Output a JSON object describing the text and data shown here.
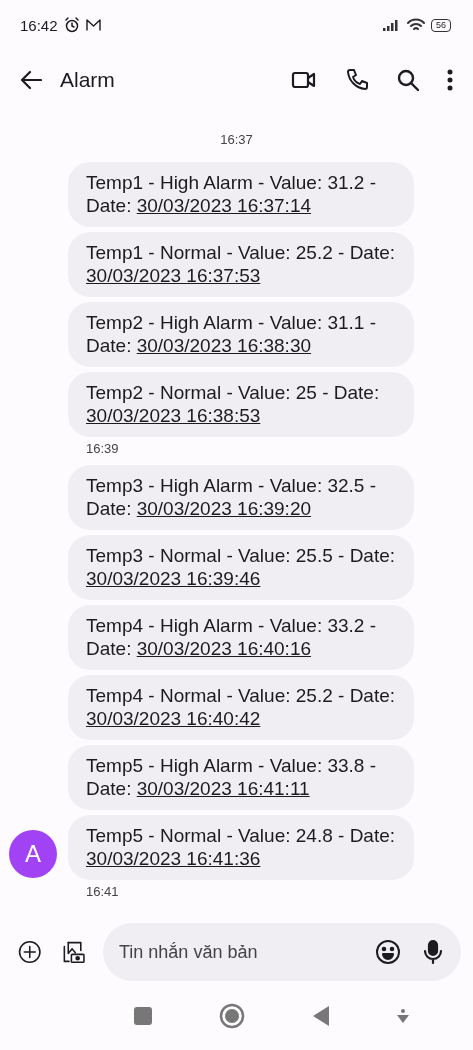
{
  "status_bar": {
    "time": "16:42",
    "battery": "56"
  },
  "header": {
    "title": "Alarm"
  },
  "thread": [
    {
      "kind": "divider",
      "time": "16:37"
    },
    {
      "kind": "message",
      "text": "Temp1 - High Alarm - Value: 31.2 - Date: ",
      "date": "30/03/2023 16:37:14"
    },
    {
      "kind": "message",
      "text": "Temp1 - Normal - Value: 25.2 - Date: ",
      "date": "30/03/2023 16:37:53"
    },
    {
      "kind": "message",
      "text": "Temp2 - High Alarm - Value: 31.1 - Date: ",
      "date": "30/03/2023 16:38:30"
    },
    {
      "kind": "message",
      "text": "Temp2 - Normal - Value: 25 - Date: ",
      "date": "30/03/2023 16:38:53"
    },
    {
      "kind": "stamp",
      "time": "16:39"
    },
    {
      "kind": "message",
      "text": "Temp3 - High Alarm - Value: 32.5 - Date: ",
      "date": "30/03/2023 16:39:20"
    },
    {
      "kind": "message",
      "text": "Temp3 - Normal - Value: 25.5 - Date: ",
      "date": "30/03/2023 16:39:46"
    },
    {
      "kind": "message",
      "text": "Temp4 - High Alarm - Value: 33.2 - Date: ",
      "date": "30/03/2023 16:40:16"
    },
    {
      "kind": "message",
      "text": "Temp4 - Normal - Value: 25.2 - Date: ",
      "date": "30/03/2023 16:40:42"
    },
    {
      "kind": "message",
      "text": "Temp5 - High Alarm - Value: 33.8 - Date: ",
      "date": "30/03/2023 16:41:11"
    },
    {
      "kind": "message",
      "text": "Temp5 - Normal - Value: 24.8 - Date: ",
      "date": "30/03/2023 16:41:36",
      "avatar": "A"
    },
    {
      "kind": "stamp",
      "time": "16:41"
    }
  ],
  "composer": {
    "placeholder": "Tin nhắn văn bản"
  }
}
